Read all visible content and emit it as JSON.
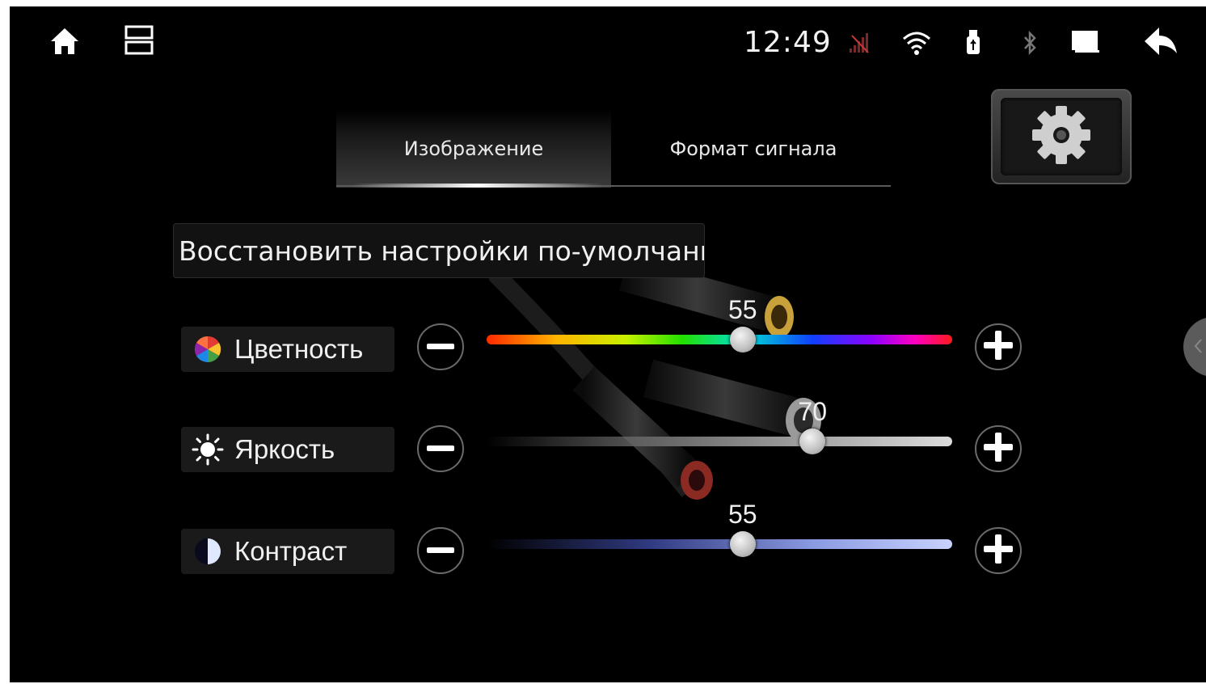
{
  "status_bar": {
    "time": "12:49",
    "icons": [
      "home-icon",
      "recent-apps-icon",
      "no-signal-icon",
      "wifi-icon",
      "usb-icon",
      "bluetooth-icon",
      "screen-icon",
      "back-icon"
    ]
  },
  "tabs": [
    {
      "label": "Изображение",
      "active": true
    },
    {
      "label": "Формат сигнала",
      "active": false
    }
  ],
  "reset_button_label": "Восстановить настройки по-умолчанию",
  "sliders": [
    {
      "label": "Цветность",
      "value": "55",
      "fraction": 0.55,
      "icon": "color-wheel-icon"
    },
    {
      "label": "Яркость",
      "value": "70",
      "fraction": 0.7,
      "icon": "sun-icon"
    },
    {
      "label": "Контраст",
      "value": "55",
      "fraction": 0.55,
      "icon": "contrast-icon"
    }
  ],
  "colors": {
    "background": "#000000",
    "text": "#f0f0f0"
  }
}
